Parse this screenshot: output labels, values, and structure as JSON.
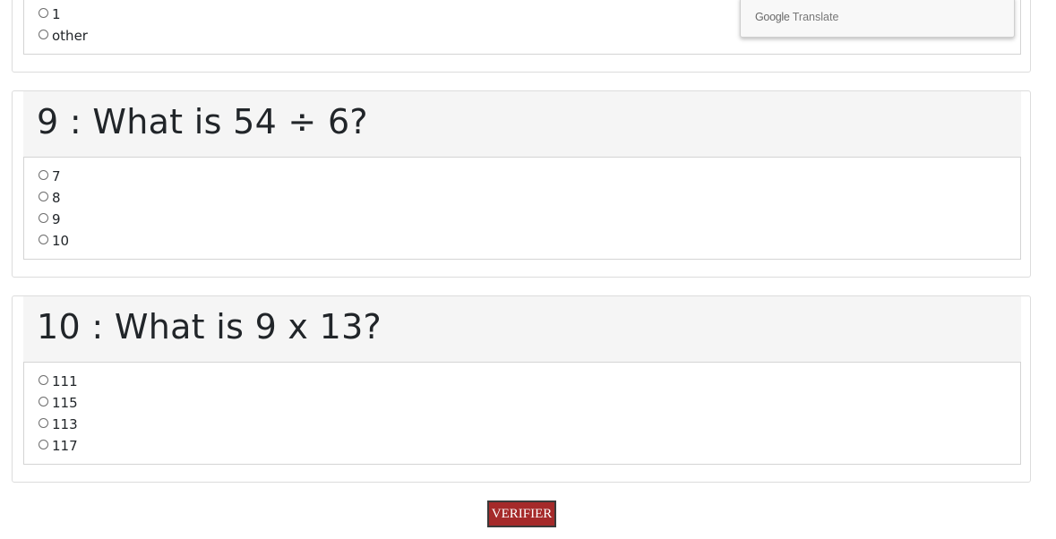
{
  "question8": {
    "options": [
      "1",
      "other"
    ]
  },
  "google_translate": {
    "brand": "Google",
    "label": "Translate"
  },
  "question9": {
    "title": "9 : What is 54 ÷ 6?",
    "options": [
      "7",
      "8",
      "9",
      "10"
    ]
  },
  "question10": {
    "title": "10 : What is 9 x 13?",
    "options": [
      "111",
      "115",
      "113",
      "117"
    ]
  },
  "submit": {
    "label": "VERIFIER"
  },
  "colors": {
    "submit_background": "#a52a2a",
    "header_background": "#f5f5f5"
  }
}
